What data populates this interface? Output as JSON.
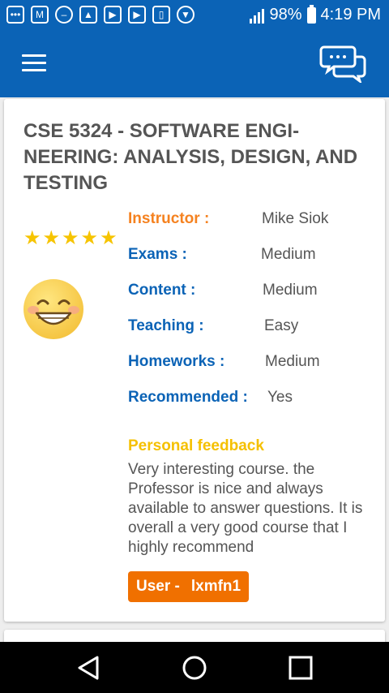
{
  "status_bar": {
    "battery": "98%",
    "time": "4:19 PM"
  },
  "course": {
    "title": "CSE 5324 - SOFTWARE ENGI-NEERING: ANALYSIS, DESIGN, AND TESTING",
    "rating_stars": 5,
    "details": [
      {
        "label": "Instructor :",
        "value": "Mike Siok"
      },
      {
        "label": "Exams :",
        "value": "Medium"
      },
      {
        "label": "Content :",
        "value": "Medium"
      },
      {
        "label": "Teaching :",
        "value": "Easy"
      },
      {
        "label": "Homeworks :",
        "value": "Medium"
      },
      {
        "label": "Recommended :",
        "value": "Yes"
      }
    ],
    "feedback_title": "Personal feedback",
    "feedback_text": "Very interesting course. the Professor is nice and always available to answer questions. It is overall a very good course that I highly recommend",
    "user_label": "User -",
    "user_name": "lxmfn1"
  },
  "colors": {
    "primary": "#0b63b6",
    "instructor_label": "#f58220",
    "feedback_title": "#f5c000",
    "user_badge": "#f07000",
    "star": "#f6c400"
  },
  "icons": {
    "menu": "hamburger-menu-icon",
    "chat": "chat-bubbles-icon",
    "emoji": "smiling-face-icon",
    "nav_back": "back-triangle-icon",
    "nav_home": "home-circle-icon",
    "nav_recents": "recents-square-icon"
  }
}
